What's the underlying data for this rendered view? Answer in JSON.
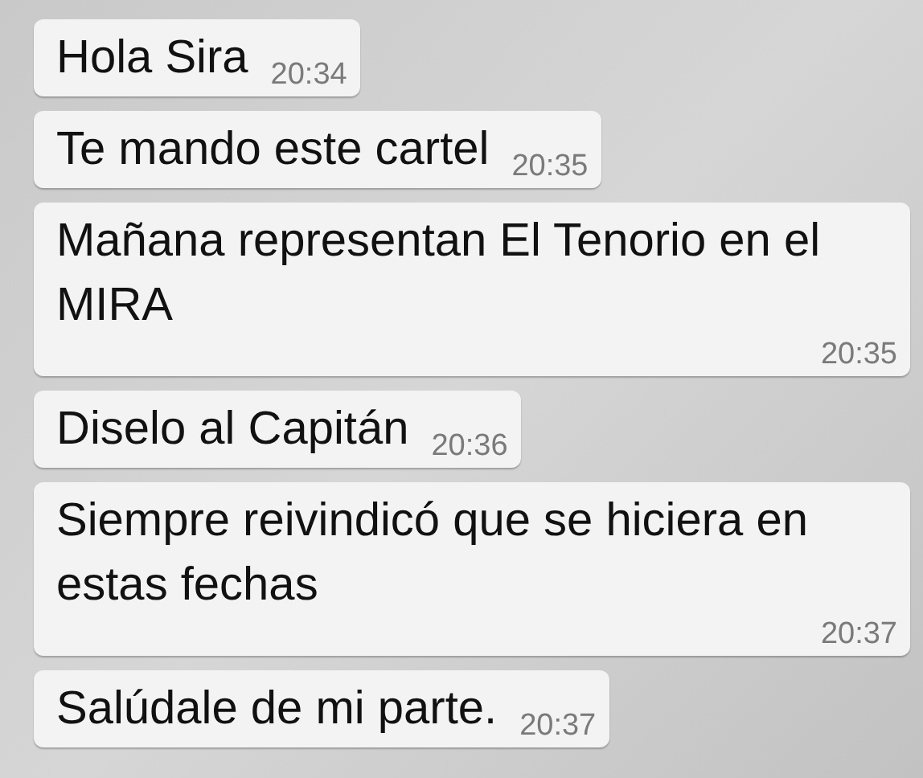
{
  "messages": [
    {
      "text": "Hola Sira",
      "time": "20:34"
    },
    {
      "text": "Te mando este cartel",
      "time": "20:35"
    },
    {
      "text": "Mañana representan El Tenorio en el MIRA",
      "time": "20:35"
    },
    {
      "text": "Diselo al Capitán",
      "time": "20:36"
    },
    {
      "text": "Siempre reivindicó que se hiciera en estas fechas",
      "time": "20:37"
    },
    {
      "text": "Salúdale de mi parte.",
      "time": "20:37"
    }
  ]
}
